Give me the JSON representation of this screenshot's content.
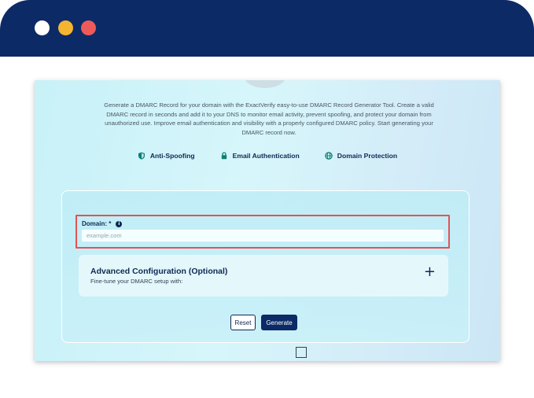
{
  "window": {
    "controls": [
      "close",
      "minimize",
      "maximize"
    ],
    "colors": {
      "chrome": "#0c2a66",
      "close": "#ffffff",
      "minimize": "#f6b531",
      "maximize": "#ee5a5a"
    }
  },
  "intro": {
    "text": "Generate a DMARC Record for your domain with the ExactVerify easy-to-use DMARC Record Generator Tool. Create a valid DMARC record in seconds and add it to your DNS to monitor email activity, prevent spoofing, and protect your domain from unauthorized use. Improve email authentication and visibility with a properly configured DMARC policy. Start generating your DMARC record now."
  },
  "features": [
    {
      "label": "Anti-Spoofing",
      "icon": "shield-icon"
    },
    {
      "label": "Email Authentication",
      "icon": "lock-icon"
    },
    {
      "label": "Domain Protection",
      "icon": "globe-icon"
    }
  ],
  "form": {
    "domain_label": "Domain: *",
    "domain_info_icon": "info-icon",
    "domain_placeholder": "example.com",
    "domain_value": "",
    "advanced_title": "Advanced Configuration (Optional)",
    "advanced_subtitle": "Fine-tune your DMARC setup with:",
    "advanced_toggle": "+",
    "reset_label": "Reset",
    "generate_label": "Generate"
  },
  "accent": {
    "navy": "#0f2854",
    "highlight": "#e25353",
    "accent_green": "#0d7f73"
  }
}
